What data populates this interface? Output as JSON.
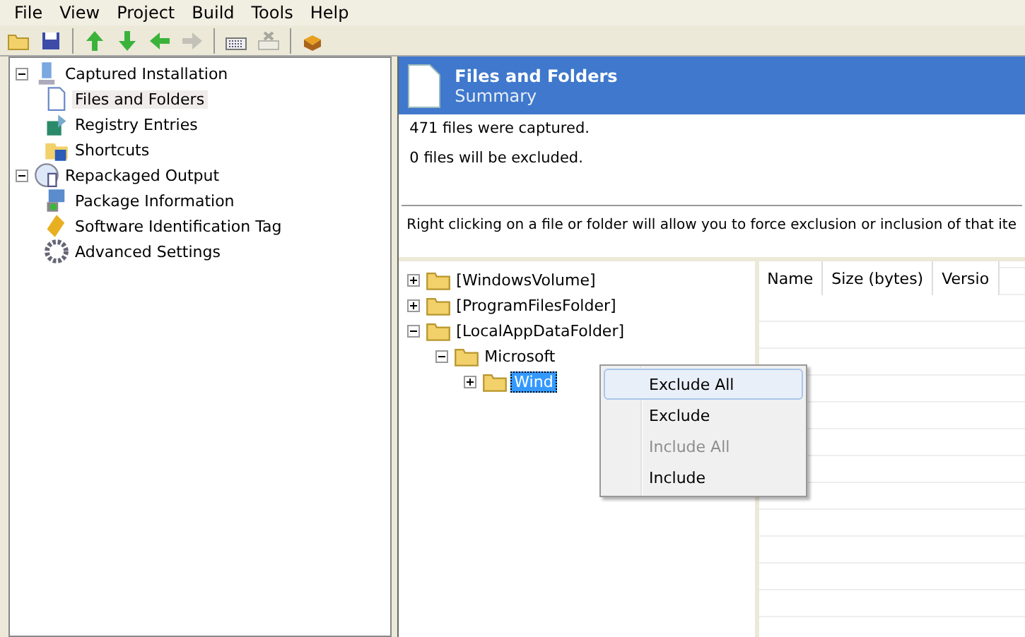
{
  "menu_bar": [
    "File",
    "View",
    "Project",
    "Build",
    "Tools",
    "Help"
  ],
  "toolbar": [
    {
      "disabled": false
    },
    {
      "disabled": false
    },
    {
      "disabled": false
    },
    {
      "disabled": false
    },
    {
      "disabled": false
    },
    {
      "disabled": true
    },
    {
      "disabled": false
    },
    {
      "disabled": true
    },
    {
      "disabled": false
    }
  ],
  "sidebar": {
    "items": [
      {
        "label": "Captured Installation",
        "expanded": true,
        "selected": false,
        "children": [
          {
            "label": "Files and Folders",
            "selected": true
          },
          {
            "label": "Registry Entries",
            "selected": false
          },
          {
            "label": "Shortcuts",
            "selected": false
          }
        ]
      },
      {
        "label": "Repackaged Output",
        "expanded": true,
        "selected": false,
        "children": [
          {
            "label": "Package Information",
            "selected": false
          },
          {
            "label": "Software Identification Tag",
            "selected": false
          },
          {
            "label": "Advanced Settings",
            "selected": false
          }
        ]
      }
    ]
  },
  "header": {
    "title": "Files and Folders",
    "subtitle": "Summary"
  },
  "summary": [
    "471 files were captured.",
    "0 files will be excluded."
  ],
  "instructions": "Right clicking on a file or folder will allow you to force exclusion or inclusion of that ite",
  "folder_tree": [
    {
      "label": "[WindowsVolume]",
      "expanded": false,
      "selected": false
    },
    {
      "label": "[ProgramFilesFolder]",
      "expanded": false,
      "selected": false
    },
    {
      "label": "[LocalAppDataFolder]",
      "expanded": true,
      "selected": false,
      "children": [
        {
          "label": "Microsoft",
          "expanded": true,
          "selected": false,
          "children": [
            {
              "label": "Wind",
              "expanded": false,
              "selected": true
            }
          ]
        }
      ]
    }
  ],
  "file_list": {
    "columns": [
      "Name",
      "Size (bytes)",
      "Versio"
    ]
  },
  "context_menu": [
    {
      "label": "Exclude All",
      "selected": true,
      "disabled": false
    },
    {
      "label": "Exclude",
      "selected": false,
      "disabled": false
    },
    {
      "label": "Include All",
      "selected": false,
      "disabled": true
    },
    {
      "label": "Include",
      "selected": false,
      "disabled": false
    }
  ]
}
